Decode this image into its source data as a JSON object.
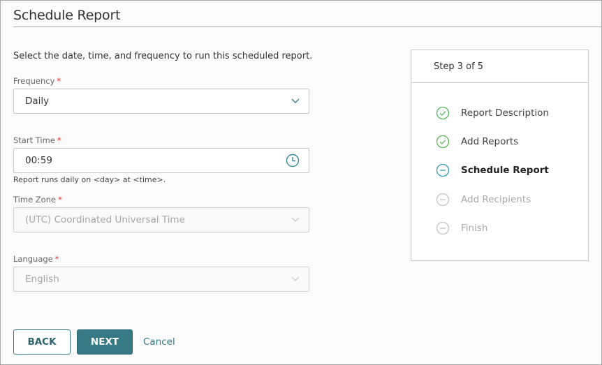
{
  "page": {
    "title": "Schedule Report",
    "intro": "Select the date, time, and frequency to run this scheduled report."
  },
  "form": {
    "required_marker": "*",
    "frequency": {
      "label": "Frequency",
      "value": "Daily",
      "icon": "chevron-down-icon"
    },
    "start_time": {
      "label": "Start Time",
      "value": "00:59",
      "icon": "clock-icon",
      "helper": "Report runs daily on <day> at <time>."
    },
    "time_zone": {
      "label": "Time Zone",
      "value": "(UTC) Coordinated Universal Time",
      "icon": "chevron-down-icon",
      "disabled": true
    },
    "language": {
      "label": "Language",
      "value": "English",
      "icon": "chevron-down-icon",
      "disabled": true
    }
  },
  "actions": {
    "back_label": "BACK",
    "next_label": "NEXT",
    "cancel_label": "Cancel"
  },
  "wizard": {
    "header": "Step 3 of 5",
    "current_step": 3,
    "total_steps": 5,
    "steps": [
      {
        "label": "Report Description",
        "status": "complete",
        "icon": "check-circle-icon"
      },
      {
        "label": "Add Reports",
        "status": "complete",
        "icon": "check-circle-icon"
      },
      {
        "label": "Schedule Report",
        "status": "current",
        "icon": "minus-circle-icon"
      },
      {
        "label": "Add Recipients",
        "status": "pending",
        "icon": "minus-circle-icon"
      },
      {
        "label": "Finish",
        "status": "pending",
        "icon": "minus-circle-icon"
      }
    ]
  },
  "colors": {
    "accent": "#377985",
    "complete": "#5cb85c",
    "current": "#3a9fb0",
    "pending": "#bdbdbd",
    "required": "#d9322b"
  }
}
